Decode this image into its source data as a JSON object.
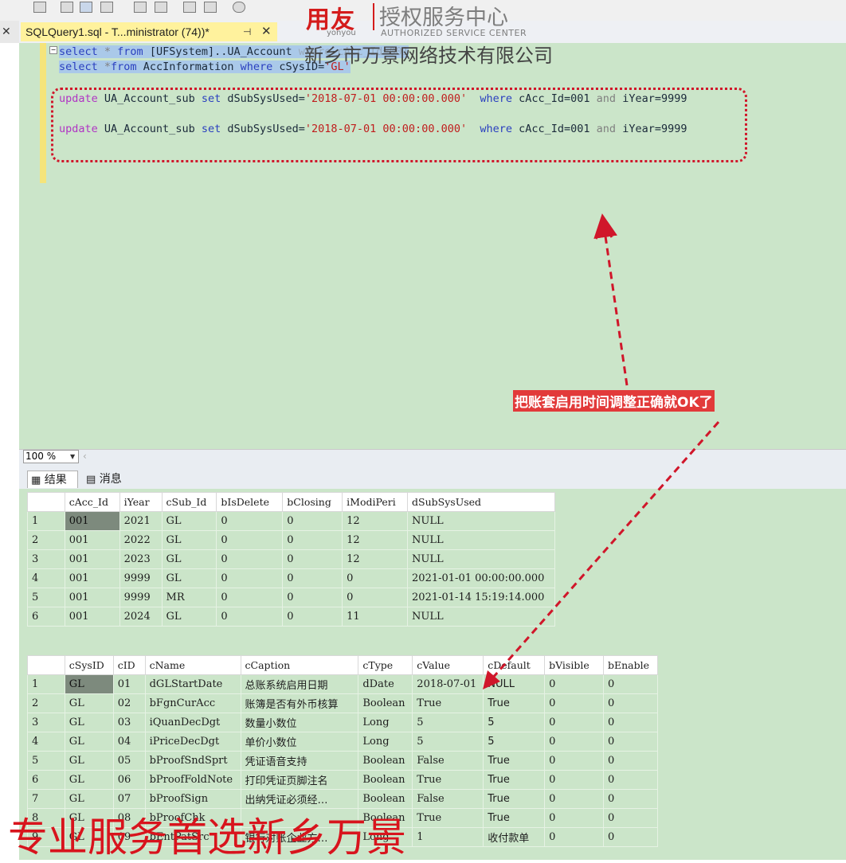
{
  "watermark": {
    "brand": "用友",
    "brand_sub": "yonyou",
    "auth_cn": "授权服务中心",
    "auth_en": "AUTHORIZED SERVICE CENTER",
    "company": "新乡市万景网络技术有限公司",
    "slogan": "专业服务首选新乡万景"
  },
  "tab": {
    "title": "SQLQuery1.sql - T...ministrator (74))*",
    "pin": "⊣",
    "close": "✕"
  },
  "editor": {
    "line1": {
      "kw1": "select",
      "op1": " * ",
      "kw2": "from",
      "rest": " [UFSystem]..UA_Account",
      "tail": " where cAcc_Id=001"
    },
    "line2": {
      "kw1": "select",
      "op1": " *",
      "kw2": "from",
      "rest": " AccInformation ",
      "kw3": "where",
      "rest2": " cSysID=",
      "str": "'GL'"
    },
    "update1": {
      "kw1": "update",
      "tbl": " UA_Account_sub ",
      "kw2": "set",
      "col": " dSubSysUsed=",
      "str": "'2018-07-01 00:00:00.000'",
      "kw3": "where",
      "cond": " cAcc_Id=001 ",
      "and": "and",
      "cond2": " iYear=9999"
    },
    "update2": {
      "kw1": "update",
      "tbl": " UA_Account_sub ",
      "kw2": "set",
      "col": " dSubSysUsed=",
      "str": "'2018-07-01 00:00:00.000'",
      "kw3": "where",
      "cond": " cAcc_Id=001 ",
      "and": "and",
      "cond2": " iYear=9999"
    }
  },
  "annotation": "把账套启用时间调整正确就OK了",
  "zoom": "100 %",
  "result_tabs": {
    "results": "结果",
    "messages": "消息"
  },
  "grid1": {
    "headers": [
      "cAcc_Id",
      "iYear",
      "cSub_Id",
      "bIsDelete",
      "bClosing",
      "iModiPeri",
      "dSubSysUsed"
    ],
    "rows": [
      [
        "1",
        "001",
        "2021",
        "GL",
        "0",
        "0",
        "12",
        "NULL"
      ],
      [
        "2",
        "001",
        "2022",
        "GL",
        "0",
        "0",
        "12",
        "NULL"
      ],
      [
        "3",
        "001",
        "2023",
        "GL",
        "0",
        "0",
        "12",
        "NULL"
      ],
      [
        "4",
        "001",
        "9999",
        "GL",
        "0",
        "0",
        "0",
        "2021-01-01 00:00:00.000"
      ],
      [
        "5",
        "001",
        "9999",
        "MR",
        "0",
        "0",
        "0",
        "2021-01-14 15:19:14.000"
      ],
      [
        "6",
        "001",
        "2024",
        "GL",
        "0",
        "0",
        "11",
        "NULL"
      ]
    ]
  },
  "grid2": {
    "headers": [
      "cSysID",
      "cID",
      "cName",
      "cCaption",
      "cType",
      "cValue",
      "cDefault",
      "bVisible",
      "bEnable"
    ],
    "rows": [
      [
        "1",
        "GL",
        "01",
        "dGLStartDate",
        "总账系统启用日期",
        "dDate",
        "2018-07-01",
        "NULL",
        "0",
        "0"
      ],
      [
        "2",
        "GL",
        "02",
        "bFgnCurAcc",
        "账簿是否有外币核算",
        "Boolean",
        "True",
        "True",
        "0",
        "0"
      ],
      [
        "3",
        "GL",
        "03",
        "iQuanDecDgt",
        "数量小数位",
        "Long",
        "5",
        "5",
        "0",
        "0"
      ],
      [
        "4",
        "GL",
        "04",
        "iPriceDecDgt",
        "单价小数位",
        "Long",
        "5",
        "5",
        "0",
        "0"
      ],
      [
        "5",
        "GL",
        "05",
        "bProofSndSprt",
        "凭证语音支持",
        "Boolean",
        "False",
        "True",
        "0",
        "0"
      ],
      [
        "6",
        "GL",
        "06",
        "bProofFoldNote",
        "打印凭证页脚注名",
        "Boolean",
        "True",
        "True",
        "0",
        "0"
      ],
      [
        "7",
        "GL",
        "07",
        "bProofSign",
        "出纳凭证必须经…",
        "Boolean",
        "False",
        "True",
        "0",
        "0"
      ],
      [
        "8",
        "GL",
        "08",
        "bProofChk",
        "",
        "Boolean",
        "True",
        "True",
        "0",
        "0"
      ],
      [
        "9",
        "GL",
        "09",
        "bEntPatSrc",
        "银行对账企业方…",
        "Long",
        "1",
        "收付款单",
        "0",
        "0"
      ]
    ]
  }
}
